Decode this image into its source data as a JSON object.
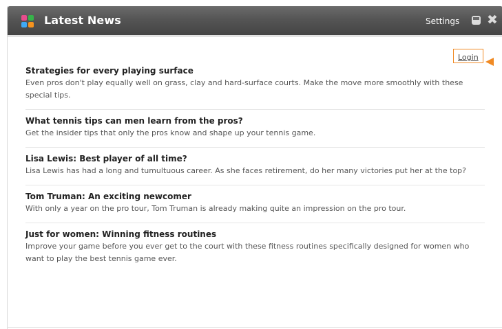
{
  "header": {
    "title": "Latest News",
    "settings_label": "Settings",
    "minimize_icon": "minimize-icon",
    "close_icon": "close-icon",
    "close_glyph": "✖"
  },
  "login": {
    "label": "Login",
    "highlight_color": "#f08a24"
  },
  "news": [
    {
      "title": "Strategies for every playing surface",
      "description": "Even pros don't play equally well on grass, clay and hard-surface courts. Make the move more smoothly with these special tips."
    },
    {
      "title": "What tennis tips can men learn from the pros?",
      "description": "Get the insider tips that only the pros know and shape up your tennis game."
    },
    {
      "title": "Lisa Lewis: Best player of all time?",
      "description": "Lisa Lewis has had a long and tumultuous career. As she faces retirement, do her many victories put her at the top?"
    },
    {
      "title": "Tom Truman: An exciting newcomer",
      "description": "With only a year on the pro tour, Tom Truman is already making quite an impression on the pro tour."
    },
    {
      "title": "Just for women: Winning fitness routines",
      "description": "Improve your game before you ever get to the court with these fitness routines specifically designed for women who want to play the best tennis game ever."
    }
  ],
  "colors": {
    "header_bg": "#555555",
    "icon_tl": "#e74c8c",
    "icon_tr": "#37b34a",
    "icon_bl": "#3fa9f5",
    "icon_br": "#f7931e"
  }
}
